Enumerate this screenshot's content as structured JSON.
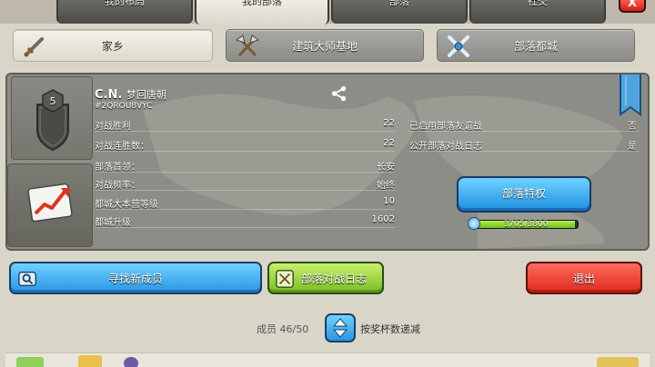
{
  "tabs": [
    {
      "label": "我的布局"
    },
    {
      "label": "我的部落"
    },
    {
      "label": "部落"
    },
    {
      "label": "社交"
    }
  ],
  "close_label": "X",
  "subtabs": [
    {
      "label": "家乡",
      "icon": "sword-icon"
    },
    {
      "label": "建筑大师基地",
      "icon": "crossed-axes-icon"
    },
    {
      "label": "部落都城",
      "icon": "crossed-swords-icon"
    }
  ],
  "clan": {
    "name": "C.N.",
    "name_suffix": "梦回唐朝",
    "tag": "#2QROU8VYC",
    "level": "5",
    "stats_left": [
      {
        "label": "对战胜利",
        "value": "22"
      },
      {
        "label": "对战连胜数：",
        "value": "22"
      },
      {
        "label": "部落首领：",
        "value": "长安"
      },
      {
        "label": "对战频率：",
        "value": "始终"
      },
      {
        "label": "都城大本营等级",
        "value": "10"
      },
      {
        "label": "都城升级",
        "value": "1602"
      }
    ],
    "stats_right": [
      {
        "label": "已启用部落友谊战",
        "value": "否"
      },
      {
        "label": "公开部落对战日志",
        "value": "是"
      }
    ],
    "perks_label": "部落特权",
    "xp_text": "3705/3800",
    "xp_fraction": 0.975
  },
  "actions": {
    "find_members": "寻找新成员",
    "war_log": "部落对战日志",
    "leave": "退出"
  },
  "members": {
    "count_text": "成员 46/50",
    "sort_label": "按奖杯数递减"
  },
  "colors": {
    "accent_blue": "#2a95e3",
    "accent_green": "#78be23",
    "accent_red": "#e02a1d"
  }
}
